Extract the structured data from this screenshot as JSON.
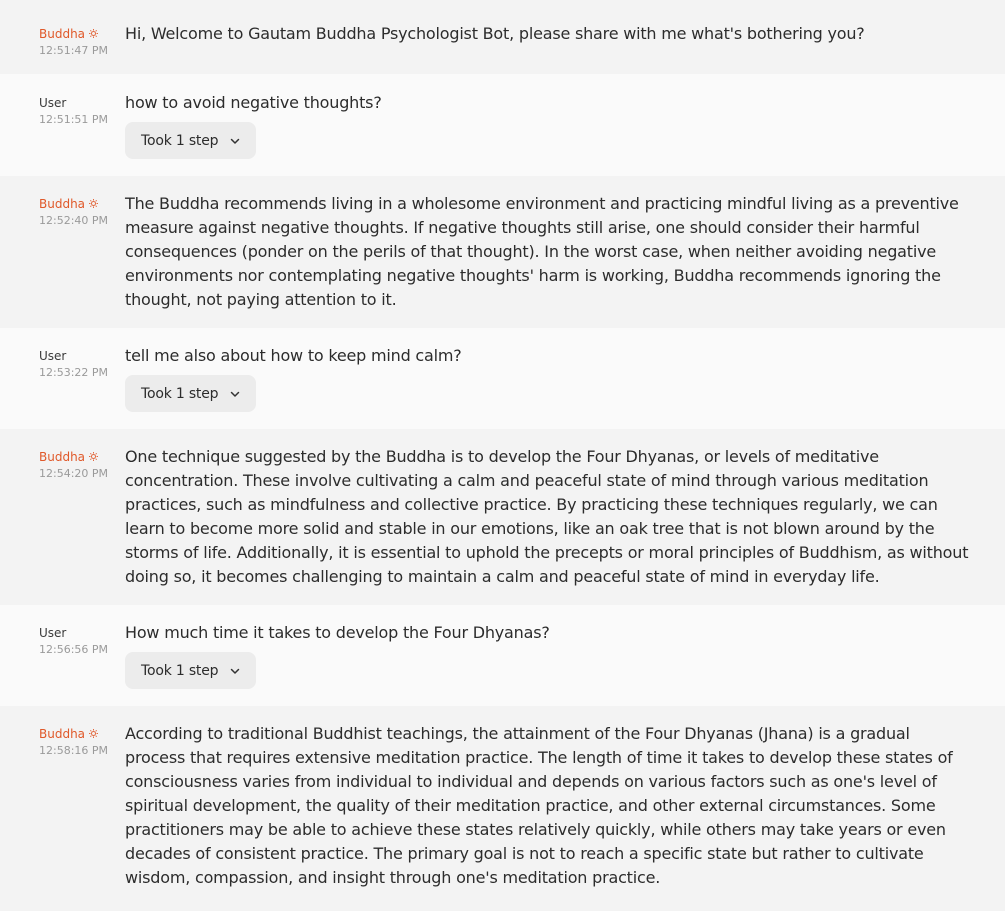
{
  "messages": [
    {
      "role": "bot",
      "author": "Buddha",
      "time": "12:51:47 PM",
      "text": "Hi, Welcome to Gautam Buddha Psychologist Bot, please share with me what's bothering you?"
    },
    {
      "role": "user",
      "author": "User",
      "time": "12:51:51 PM",
      "text": "how to avoid negative thoughts?",
      "step_label": "Took 1 step"
    },
    {
      "role": "bot",
      "author": "Buddha",
      "time": "12:52:40 PM",
      "text": "The Buddha recommends living in a wholesome environment and practicing mindful living as a preventive measure against negative thoughts. If negative thoughts still arise, one should consider their harmful consequences (ponder on the perils of that thought). In the worst case, when neither avoiding negative environments nor contemplating negative thoughts' harm is working, Buddha recommends ignoring the thought, not paying attention to it."
    },
    {
      "role": "user",
      "author": "User",
      "time": "12:53:22 PM",
      "text": "tell me also about how to keep mind calm?",
      "step_label": "Took 1 step"
    },
    {
      "role": "bot",
      "author": "Buddha",
      "time": "12:54:20 PM",
      "text": "One technique suggested by the Buddha is to develop the Four Dhyanas, or levels of meditative concentration. These involve cultivating a calm and peaceful state of mind through various meditation practices, such as mindfulness and collective practice. By practicing these techniques regularly, we can learn to become more solid and stable in our emotions, like an oak tree that is not blown around by the storms of life. Additionally, it is essential to uphold the precepts or moral principles of Buddhism, as without doing so, it becomes challenging to maintain a calm and peaceful state of mind in everyday life."
    },
    {
      "role": "user",
      "author": "User",
      "time": "12:56:56 PM",
      "text": "How much time it takes to develop the Four Dhyanas?",
      "step_label": "Took 1 step"
    },
    {
      "role": "bot",
      "author": "Buddha",
      "time": "12:58:16 PM",
      "text": "According to traditional Buddhist teachings, the attainment of the Four Dhyanas (Jhana) is a gradual process that requires extensive meditation practice. The length of time it takes to develop these states of consciousness varies from individual to individual and depends on various factors such as one's level of spiritual development, the quality of their meditation practice, and other external circumstances. Some practitioners may be able to achieve these states relatively quickly, while others may take years or even decades of consistent practice. The primary goal is not to reach a specific state but rather to cultivate wisdom, compassion, and insight through one's meditation practice."
    }
  ],
  "colors": {
    "bot_author": "#e0592a",
    "bot_row_bg": "#f3f3f3",
    "user_row_bg": "#fafafa",
    "step_button_bg": "#ececec"
  },
  "icons": {
    "bot_author_icon": "sun-icon",
    "step_expand_icon": "chevron-down-icon"
  }
}
